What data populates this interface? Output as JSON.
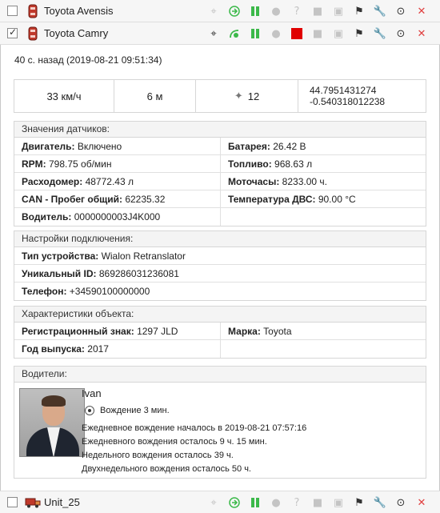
{
  "units": [
    {
      "name": "Toyota Avensis",
      "checked": false
    },
    {
      "name": "Toyota Camry",
      "checked": true
    },
    {
      "name": "Unit_25",
      "checked": false
    }
  ],
  "updated": "40 с. назад (2019-08-21 09:51:34)",
  "stats": {
    "speed": "33 км/ч",
    "altitude": "6 м",
    "satellites": "12",
    "lat": "44.7951431274",
    "lon": "-0.540318012238"
  },
  "sensors": {
    "title": "Значения датчиков:",
    "rows": [
      {
        "k": "Двигатель:",
        "v": " Включено"
      },
      {
        "k": "Батарея:",
        "v": " 26.42 В"
      },
      {
        "k": "RPM:",
        "v": " 798.75 об/мин"
      },
      {
        "k": "Топливо:",
        "v": " 968.63 л"
      },
      {
        "k": "Расходомер:",
        "v": " 48772.43 л"
      },
      {
        "k": "Моточасы:",
        "v": " 8233.00 ч."
      },
      {
        "k": "CAN - Пробег общий:",
        "v": " 62235.32"
      },
      {
        "k": "Температура ДВС:",
        "v": " 90.00 °C"
      },
      {
        "k": "Водитель:",
        "v": " 0000000003J4K000"
      },
      {
        "k": "",
        "v": ""
      }
    ]
  },
  "connection": {
    "title": "Настройки подключения:",
    "rows": [
      {
        "k": "Тип устройства:",
        "v": " Wialon Retranslator"
      },
      {
        "k": "Уникальный ID:",
        "v": " 869286031236081"
      },
      {
        "k": "Телефон:",
        "v": " +34590100000000"
      }
    ]
  },
  "characteristics": {
    "title": "Характеристики объекта:",
    "rows": [
      {
        "k": "Регистрационный знак:",
        "v": " 1297 JLD"
      },
      {
        "k": "Марка:",
        "v": " Toyota"
      },
      {
        "k": "Год выпуска:",
        "v": " 2017"
      },
      {
        "k": "",
        "v": ""
      }
    ]
  },
  "drivers": {
    "title": "Водители:",
    "name": "Ivan",
    "status": "Вождение 3 мин.",
    "lines": [
      "Ежедневное вождение началось в 2019-08-21 07:57:16",
      "Ежедневного вождения осталось 9 ч. 15 мин.",
      "Недельного вождения осталось 39 ч.",
      "Двухнедельного вождения осталось 50 ч."
    ]
  },
  "icons": [
    "locate-icon",
    "route-icon",
    "play-icon",
    "record-icon",
    "help-icon",
    "video-icon",
    "camera-icon",
    "flag-icon",
    "wrench-icon",
    "menu-icon",
    "delete-icon"
  ],
  "colors": {
    "green": "#3cb94a",
    "red": "#e04040",
    "accent_stop": "#e00000"
  }
}
